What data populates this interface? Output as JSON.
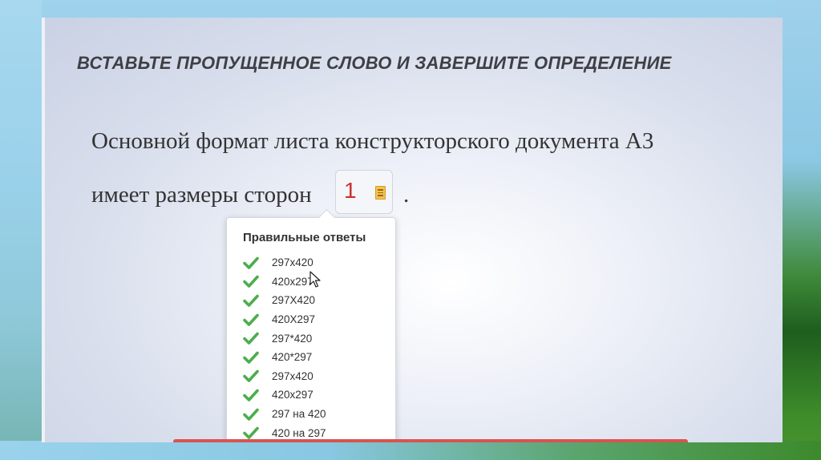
{
  "question": {
    "title": "ВСТАВЬТЕ ПРОПУЩЕННОЕ СЛОВО И ЗАВЕРШИТЕ ОПРЕДЕЛЕНИЕ",
    "line1": "Основной формат листа конструкторского документа А3",
    "line2": "имеет размеры сторон",
    "period": ".",
    "answer_value": "1"
  },
  "popup": {
    "title": "Правильные ответы",
    "answers": [
      "297x420",
      "420x297",
      "297X420",
      "420X297",
      "297*420",
      "420*297",
      "297х420",
      "420х297",
      "297 на 420",
      "420 на 297"
    ]
  },
  "icons": {
    "answer_icon": "document-icon",
    "check_icon": "check-icon",
    "cursor_icon": "mouse-pointer-icon"
  },
  "colors": {
    "answer_value": "#c8322a",
    "check": "#4cae4c",
    "doc_icon": "#f3c24f",
    "red_bar": "#d9534f"
  }
}
